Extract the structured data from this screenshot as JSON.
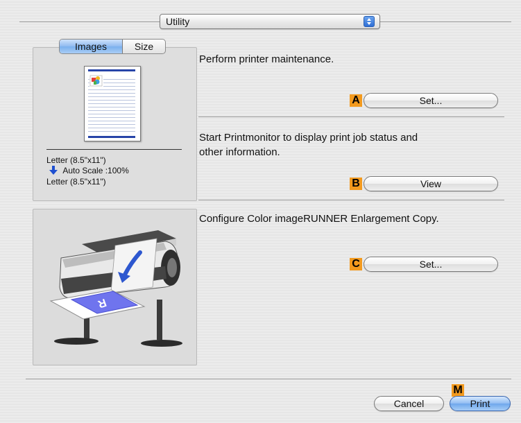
{
  "header": {
    "popup_label": "Utility"
  },
  "preview": {
    "tabs": [
      {
        "label": "Images",
        "selected": true
      },
      {
        "label": "Size",
        "selected": false
      }
    ],
    "paper_size_line": "Letter (8.5\"x11\")",
    "auto_scale_line": "Auto Scale :100%",
    "output_size_line": "Letter (8.5\"x11\")"
  },
  "sections": [
    {
      "description": "Perform printer maintenance.",
      "marker": "A",
      "button_label": "Set..."
    },
    {
      "description_line1": "Start Printmonitor to display print job status and",
      "description_line2": "other information.",
      "marker": "B",
      "button_label": "View"
    },
    {
      "description": "Configure Color imageRUNNER Enlargement Copy.",
      "marker": "C",
      "button_label": "Set..."
    }
  ],
  "footer": {
    "marker": "M",
    "cancel_label": "Cancel",
    "print_label": "Print"
  },
  "colors": {
    "marker": "#f39a1e",
    "accent_blue": "#2f6fd6"
  }
}
